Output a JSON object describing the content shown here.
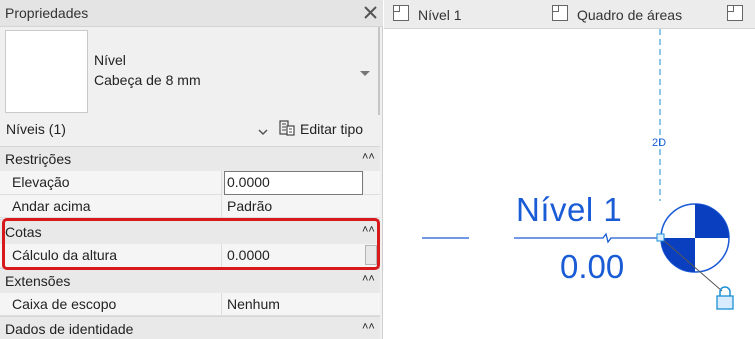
{
  "properties_panel": {
    "title": "Propriedades",
    "type_selector": {
      "family": "Nível",
      "type": "Cabeça de 8 mm"
    },
    "filter": {
      "label": "Níveis (1)",
      "edit_type_label": "Editar tipo"
    },
    "categories": [
      {
        "name": "Restrições",
        "collapse_glyph": "˄˄"
      },
      {
        "name": "Cotas",
        "collapse_glyph": "˄˄"
      },
      {
        "name": "Extensões",
        "collapse_glyph": "˄˄"
      },
      {
        "name": "Dados de identidade",
        "collapse_glyph": "˄˄"
      }
    ],
    "properties": [
      {
        "name": "Elevação",
        "value": "0.0000"
      },
      {
        "name": "Andar acima",
        "value": "Padrão"
      },
      {
        "name": "Cálculo da altura",
        "value": "0.0000"
      },
      {
        "name": "Caixa de escopo",
        "value": "Nenhum"
      }
    ]
  },
  "view_tabs": [
    {
      "label": "Nível 1",
      "icon": "view-icon"
    },
    {
      "label": "Quadro de áreas",
      "icon": "schedule-icon"
    },
    {
      "label": "",
      "icon": "view-icon"
    }
  ],
  "canvas": {
    "level_name": "Nível 1",
    "level_elevation": "0.00",
    "grid_label": "2D"
  },
  "colors": {
    "annotation_blue": "#1a5bd6",
    "highlight_red": "#d7191c"
  }
}
